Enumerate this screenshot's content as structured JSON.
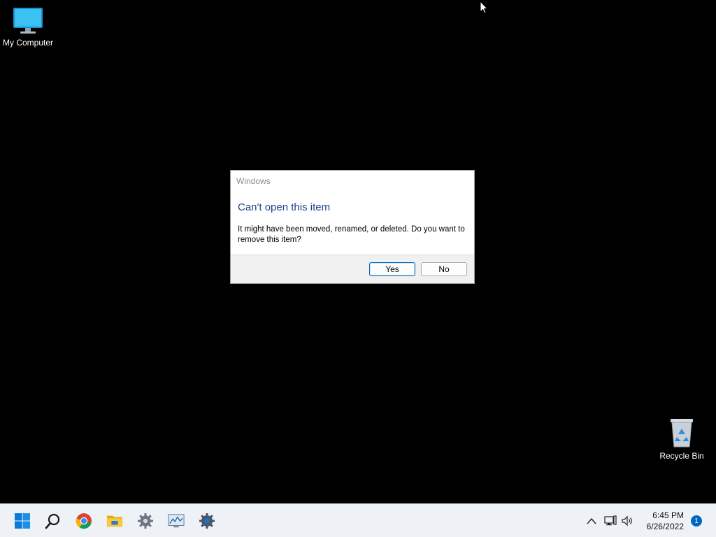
{
  "desktop": {
    "icons": [
      {
        "label": "My Computer"
      },
      {
        "label": "Recycle Bin"
      }
    ]
  },
  "dialog": {
    "title": "Windows",
    "heading": "Can't open this item",
    "message": "It might have been moved, renamed, or deleted. Do you want to remove this item?",
    "yes_label": "Yes",
    "no_label": "No"
  },
  "taskbar": {
    "pinned": [
      "start-icon",
      "search-icon",
      "chrome-icon",
      "file-explorer-icon",
      "settings-gear-icon",
      "performance-monitor-icon",
      "control-gear-icon"
    ],
    "tray": [
      "chevron-up-icon",
      "network-icon",
      "volume-icon"
    ],
    "clock": {
      "time": "6:45 PM",
      "date": "6/26/2022"
    },
    "notification_count": "1"
  },
  "colors": {
    "accent": "#0067c0",
    "heading": "#1f3f8c",
    "taskbar_bg": "#eef1f6"
  }
}
